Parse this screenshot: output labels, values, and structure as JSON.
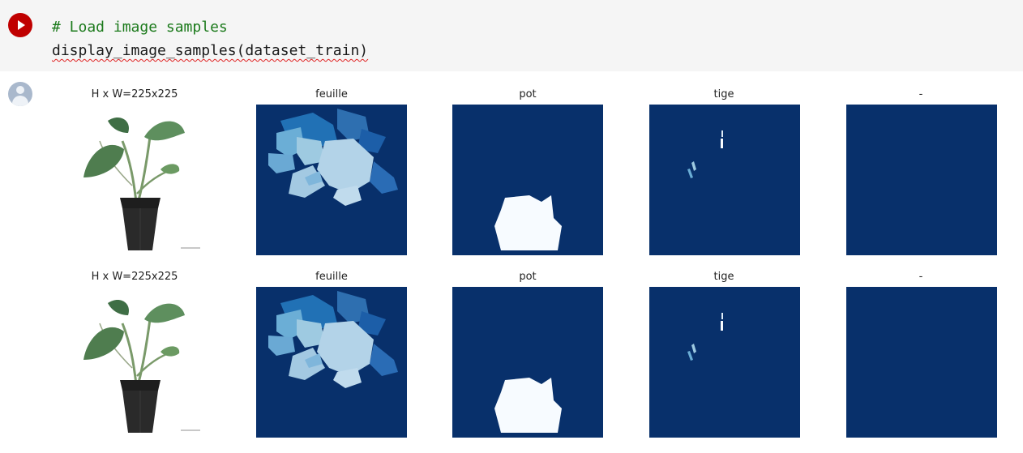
{
  "cell": {
    "code_comment": "# Load image samples",
    "code_call": "display_image_samples(dataset_train)",
    "run_icon": "play-icon",
    "output_icon": "user-avatar-icon"
  },
  "figure": {
    "rows": [
      {
        "panels": [
          {
            "title": "H x W=225x225",
            "kind": "photo"
          },
          {
            "title": "feuille",
            "kind": "mask-leaf"
          },
          {
            "title": "pot",
            "kind": "mask-pot"
          },
          {
            "title": "tige",
            "kind": "mask-stem"
          },
          {
            "title": "-",
            "kind": "mask-empty"
          }
        ]
      },
      {
        "panels": [
          {
            "title": "H x W=225x225",
            "kind": "photo"
          },
          {
            "title": "feuille",
            "kind": "mask-leaf"
          },
          {
            "title": "pot",
            "kind": "mask-pot"
          },
          {
            "title": "tige",
            "kind": "mask-stem"
          },
          {
            "title": "-",
            "kind": "mask-empty"
          }
        ]
      }
    ],
    "colormap": {
      "background": "#08306b",
      "light": "#f7fbff"
    }
  }
}
